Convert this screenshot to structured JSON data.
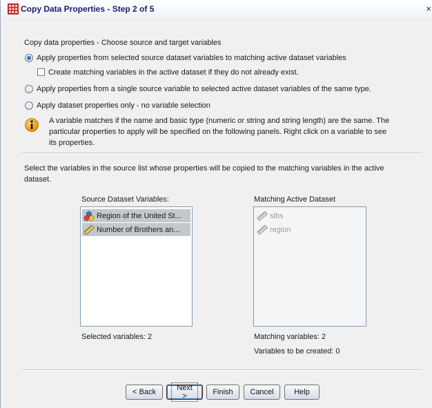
{
  "window": {
    "title": "Copy Data Properties - Step 2 of 5",
    "close_glyph": "×",
    "app_icon": "spreadsheet-grid-icon"
  },
  "section_label": "Copy data properties - Choose source and target variables",
  "options": {
    "apply_selected": "Apply properties from selected source dataset variables to matching active dataset variables",
    "create_matching": "Create matching variables in the active dataset if they do not already  exist.",
    "apply_single": "Apply properties from a single source variable to selected active dataset variables of the same type.",
    "apply_dataset_only": "Apply dataset properties only  -  no variable selection"
  },
  "info_text": {
    "line1": "A variable matches if the name and basic type (numeric or string and string length) are the same. The",
    "line2": "particular properties to apply will be specified on the following panels. Right click on a variable to see",
    "line3": "its properties."
  },
  "select_text": {
    "line1": "Select the variables in the source list whose properties will be copied to the matching variables in the active",
    "line2": "dataset."
  },
  "source": {
    "label": "Source Dataset Variables:",
    "items": [
      {
        "text": "Region of the United St...",
        "icon": "nominal-variable-icon"
      },
      {
        "text": "Number of Brothers an...",
        "icon": "scale-ruler-icon"
      }
    ],
    "status": "Selected variables: 2"
  },
  "matching": {
    "label": "Matching Active Dataset",
    "items": [
      {
        "text": "sibs",
        "icon": "scale-ruler-icon"
      },
      {
        "text": "region",
        "icon": "scale-ruler-icon"
      }
    ],
    "status": "Matching variables: 2",
    "to_create": "Variables to be created: 0"
  },
  "buttons": {
    "back": "< Back",
    "next": "Next >",
    "finish": "Finish",
    "cancel": "Cancel",
    "help": "Help"
  }
}
